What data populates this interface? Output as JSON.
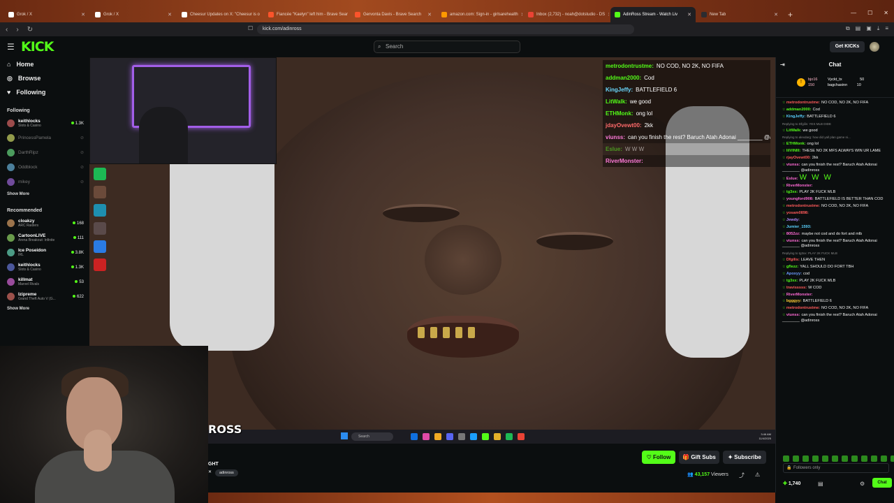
{
  "browser": {
    "tabs": [
      {
        "title": "Grok / X",
        "fav": "#ffffff"
      },
      {
        "title": "Grok / X",
        "fav": "#ffffff"
      },
      {
        "title": "Cheesur Updates on X: \"Cheesur is o",
        "fav": "#ffffff"
      },
      {
        "title": "Fiancée \"Kaelyn\" left him - Brave Sear",
        "fav": "#fb542b"
      },
      {
        "title": "Gervonta Davis - Brave Search",
        "fav": "#fb542b"
      },
      {
        "title": "amazon.com: Sign-in - girlsarehealth",
        "fav": "#ff9900"
      },
      {
        "title": "Inbox (2,732) - noah@dotstudio - DS",
        "fav": "#ea4335"
      },
      {
        "title": "AdinRoss Stream - Watch Liv",
        "fav": "#53fc18",
        "active": true
      },
      {
        "title": "New Tab",
        "fav": "#2c2c30"
      }
    ],
    "url": "kick.com/adinross"
  },
  "topbar": {
    "logo": "KICK",
    "search_placeholder": "Search",
    "get_kicks": "Get KICKs"
  },
  "sidebar": {
    "nav": [
      {
        "label": "Home",
        "icon": "home-icon"
      },
      {
        "label": "Browse",
        "icon": "compass-icon"
      },
      {
        "label": "Following",
        "icon": "heart-icon"
      }
    ],
    "following_title": "Following",
    "following": [
      {
        "name": "keithlocks",
        "category": "Slots & Casino",
        "viewers": "1.3K",
        "live": true
      },
      {
        "name": "PrincessPamela",
        "category": "",
        "viewers": "",
        "live": false
      },
      {
        "name": "DarthRipz",
        "category": "",
        "viewers": "",
        "live": false
      },
      {
        "name": "Oddblock",
        "category": "",
        "viewers": "",
        "live": false
      },
      {
        "name": "mikey",
        "category": "",
        "viewers": "",
        "live": false
      }
    ],
    "show_more": "Show More",
    "recommended_title": "Recommended",
    "recommended": [
      {
        "name": "cloakzy",
        "category": "ARC Raiders",
        "viewers": "168",
        "live": true
      },
      {
        "name": "CartoonLIVE",
        "category": "Arena Breakout: Infinite",
        "viewers": "111",
        "live": true
      },
      {
        "name": "Ice Poseidon",
        "category": "IRL",
        "viewers": "3.8K",
        "live": true
      },
      {
        "name": "keithlocks",
        "category": "Slots & Casino",
        "viewers": "1.3K",
        "live": true
      },
      {
        "name": "killmat",
        "category": "Marvel Rivals",
        "viewers": "53",
        "live": true
      },
      {
        "name": "Izipreme",
        "category": "Grand Theft Auto V (G...",
        "viewers": "622",
        "live": true
      }
    ],
    "show_more_2": "Show More"
  },
  "stream": {
    "overlay_logo": "ROSS",
    "overlay_chat": [
      {
        "user": "metrodontrustme:",
        "text": "NO COD, NO 2K, NO FIFA",
        "color": "green"
      },
      {
        "user": "addman2000:",
        "text": "Cod",
        "color": "green"
      },
      {
        "user": "KingJeffy:",
        "text": "BATTLEFIELD 6",
        "color": "cyan"
      },
      {
        "user": "LitWalk:",
        "text": "we good",
        "color": "green"
      },
      {
        "user": "ETHMonk:",
        "text": "ong lol",
        "color": "green"
      },
      {
        "user": "jdayOvewt00:",
        "text": "2kk",
        "color": "red"
      },
      {
        "user": "viunss:",
        "text": "can you finish the rest? Baruch Atah Adonai ________ @adinross",
        "color": "pink"
      },
      {
        "user": "Eslue:",
        "text": "W W W",
        "color": "green",
        "fade": true
      },
      {
        "user": "RiverMonster:",
        "text": "",
        "color": "pink"
      }
    ],
    "taskbar": {
      "search": "Search",
      "time": "3:46 AM",
      "date": "11/4/2025"
    }
  },
  "info": {
    "title_fragment": "GHT",
    "tag": "adinross",
    "follow": "Follow",
    "gift": "Gift Subs",
    "subscribe": "Subscribe",
    "viewers": "43,157",
    "viewers_label": "Viewers"
  },
  "chat": {
    "title": "Chat",
    "pinned": {
      "user": "bjo16",
      "amount": "150",
      "row1": "Vyckt_tx",
      "row1_val": "50",
      "row2": "bagchasinn",
      "row2_val": "10"
    },
    "messages": [
      {
        "user": "metrodontrustme:",
        "text": "NO COD, NO 2K, NO FIFA",
        "color": "red"
      },
      {
        "user": "addman2000:",
        "text": "Cod",
        "color": "green"
      },
      {
        "user": "KingJeffy:",
        "text": "BATTLEFIELD 6",
        "color": "cyan"
      },
      {
        "reply": "Replying to Dfgilis: YES MLB DIDE"
      },
      {
        "user": "LitWalk:",
        "text": "we good",
        "color": "green"
      },
      {
        "reply": "Replying to alexdarg: how did yall plan game ni..."
      },
      {
        "user": "ETHMonk:",
        "text": "ong lol",
        "color": "green"
      },
      {
        "user": "lilVINIII:",
        "text": "THESE NO 2K MFS ALWAYS WIN UR LAME",
        "color": "green"
      },
      {
        "user": "rjayOvewt00:",
        "text": "2kk",
        "color": "red"
      },
      {
        "user": "viunss:",
        "text": "can you finish the rest? Baruch Atah Adonai ________ @adinross",
        "color": "pink"
      },
      {
        "user": "Eslue:",
        "text": "W W W",
        "color": "pink",
        "big": true
      },
      {
        "user": "RiverMonster:",
        "text": "",
        "color": "pink"
      },
      {
        "user": "tg3xx:",
        "text": "PLAY 2K FUCK MLB",
        "color": "green"
      },
      {
        "user": "youngford908:",
        "text": "BATTLEFIELD IS BETTER THAN COD",
        "color": "pink"
      },
      {
        "user": "metrodontrustme:",
        "text": "NO COD, NO 2K, NO FIFA",
        "color": "red"
      },
      {
        "user": "yosam0898:",
        "text": "",
        "color": "red"
      },
      {
        "user": "Jewdy:",
        "text": "",
        "color": "purple"
      },
      {
        "user": "Jumier_1593:",
        "text": "",
        "color": "cyan"
      },
      {
        "user": "8052zz:",
        "text": "maybe not cod and do fort and mlb",
        "color": "pink"
      },
      {
        "user": "viunss:",
        "text": "can you finish the rest? Baruch Atah Adonai ________ @adinross",
        "color": "pink"
      },
      {
        "reply": "Replying to tg3xx: PLAY 2K FUCK MLB"
      },
      {
        "user": "Dfgilis:",
        "text": "LEAVE THEN",
        "color": "red"
      },
      {
        "user": "gflezz:",
        "text": "YALL SHOULD DO FORT TBH",
        "color": "green"
      },
      {
        "user": "Apoxyy:",
        "text": "cod",
        "color": "blue"
      },
      {
        "user": "tg3xx:",
        "text": "PLAY 2K FUCK MLB",
        "color": "green"
      },
      {
        "user": "travisssss:",
        "text": "W COD",
        "color": "red"
      },
      {
        "user": "RiverMonster:",
        "text": "",
        "color": "pink"
      },
      {
        "user": "bgggyy:",
        "text": "BATTLEFIELD 6",
        "color": "gold"
      },
      {
        "user": "metrodontrustme:",
        "text": "NO COD, NO 2K, NO FIFA",
        "color": "red"
      },
      {
        "user": "viunss:",
        "text": "can you finish the rest? Baruch Atah Adonai ________ @adinross",
        "color": "pink"
      }
    ],
    "input_placeholder": "Followers only",
    "points": "1,740",
    "send": "Chat"
  }
}
